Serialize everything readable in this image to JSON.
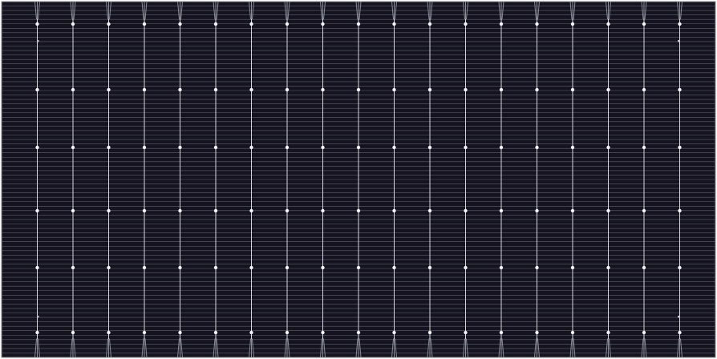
{
  "panel": {
    "cell_columns": 20,
    "busbar_rows": 6,
    "finger_line_count": 80,
    "colors": {
      "background": "#ffffff",
      "cell_fill": "#14131f",
      "cell_border": "#8c8d9a",
      "finger_line": "#5f6070",
      "busbar": "#d6d7de",
      "solder_point": "#f4f5f8",
      "corner_mark": "#bfc0c8"
    },
    "icons": {
      "solder_point": "solder-point-icon",
      "corner_mark": "corner-mark-icon"
    }
  }
}
